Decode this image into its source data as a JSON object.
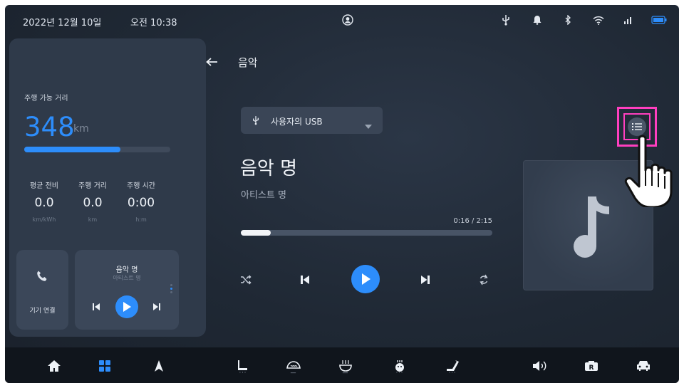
{
  "status_bar": {
    "date": "2022년 12월 10일",
    "time": "오전 10:38"
  },
  "vehicle": {
    "range_label": "주행 가능 거리",
    "range_value": "348",
    "range_unit": "km",
    "range_level": 0.66,
    "stats": [
      {
        "label": "평균 전비",
        "value": "0.0",
        "unit": "km/kWh"
      },
      {
        "label": "주행 거리",
        "value": "0.0",
        "unit": "km"
      },
      {
        "label": "주행 시간",
        "value": "0:00",
        "unit": "h:m"
      }
    ]
  },
  "phone_card": {
    "label": "기기 연결"
  },
  "now_playing_card": {
    "title": "음악 명",
    "artist": "아티스트 명"
  },
  "music": {
    "page_title": "음악",
    "source": "사용자의 USB",
    "song_title": "음악 명",
    "artist": "아티스트 명",
    "time_display": "0:16 / 2:15",
    "progress": 0.12
  },
  "colors": {
    "accent": "#2d8dfb",
    "highlight": "#ff3fbf",
    "background": "#1f2834",
    "dock": "#10151c"
  },
  "icons": {
    "status": [
      "user-icon",
      "usb-icon",
      "bell-icon",
      "bluetooth-icon",
      "wifi-icon",
      "signal-icon",
      "battery-icon"
    ],
    "player": [
      "shuffle-icon",
      "previous-icon",
      "play-icon",
      "next-icon",
      "repeat-icon"
    ],
    "dock": [
      "home-icon",
      "apps-icon",
      "navigation-icon",
      "seat-icon",
      "defrost-front-icon",
      "defrost-rear-icon",
      "seat-heater-icon",
      "seat-recline-icon",
      "volume-icon",
      "camera-icon",
      "car-icon"
    ]
  }
}
